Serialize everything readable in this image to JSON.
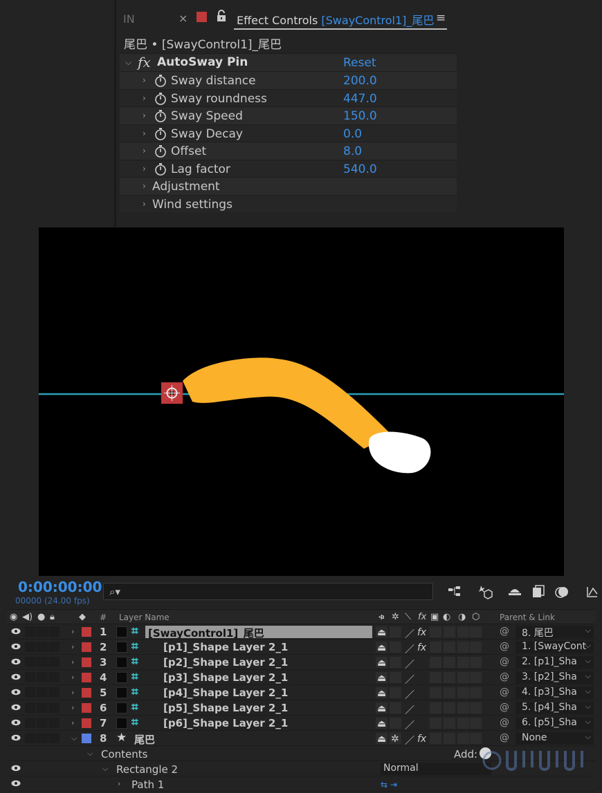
{
  "effect_controls": {
    "tab_in": "IN",
    "tab_close": "×",
    "tab_title": "Effect Controls",
    "tab_layer": "[SwayControl1]_尾巴",
    "menu_glyph": "≡",
    "breadcrumb": "尾巴 • [SwayControl1]_尾巴",
    "effect": {
      "name": "AutoSway Pin",
      "reset_label": "Reset",
      "fx_glyph": "fx"
    },
    "properties": [
      {
        "label": "Sway distance",
        "value": "200.0"
      },
      {
        "label": "Sway roundness",
        "value": "447.0"
      },
      {
        "label": "Sway Speed",
        "value": "150.0"
      },
      {
        "label": "Sway Decay",
        "value": "0.0"
      },
      {
        "label": "Offset",
        "value": "8.0"
      },
      {
        "label": "Lag factor",
        "value": "540.0"
      }
    ],
    "groups": [
      "Adjustment",
      "Wind settings"
    ]
  },
  "viewer": {
    "background": "#000000",
    "guide_color": "#2aa0b8",
    "tail_color": "#fbb12a",
    "tip_color": "#ffffff",
    "pin_color": "#c0393b"
  },
  "timeline": {
    "timecode": "0:00:00:00",
    "frames_fps": "00000 (24.00 fps)",
    "search_glyph": "⌕▾",
    "header": {
      "number": "#",
      "layer_name": "Layer Name",
      "parent_link": "Parent & Link"
    },
    "layers": [
      {
        "num": "1",
        "name": "[SwayControl1]_尾巴",
        "color": "#c0393b",
        "parent": "8. 尾巴",
        "fx": true,
        "selected": true
      },
      {
        "num": "2",
        "name": "[p1]_Shape Layer 2_1",
        "color": "#c0393b",
        "parent": "1. [SwayCont",
        "fx": true,
        "selected": false
      },
      {
        "num": "3",
        "name": "[p2]_Shape Layer 2_1",
        "color": "#c0393b",
        "parent": "2.  [p1]_Sha",
        "fx": false,
        "selected": false
      },
      {
        "num": "4",
        "name": "[p3]_Shape Layer 2_1",
        "color": "#c0393b",
        "parent": "3.  [p2]_Sha",
        "fx": false,
        "selected": false
      },
      {
        "num": "5",
        "name": "[p4]_Shape Layer 2_1",
        "color": "#c0393b",
        "parent": "4.  [p3]_Sha",
        "fx": false,
        "selected": false
      },
      {
        "num": "6",
        "name": "[p5]_Shape Layer 2_1",
        "color": "#c0393b",
        "parent": "5.  [p4]_Sha",
        "fx": false,
        "selected": false
      },
      {
        "num": "7",
        "name": "[p6]_Shape Layer 2_1",
        "color": "#c0393b",
        "parent": "6.  [p5]_Sha",
        "fx": false,
        "selected": false
      }
    ],
    "shape_layer": {
      "num": "8",
      "name": "尾巴",
      "color": "#5b7fe0",
      "parent": "None"
    },
    "contents_label": "Contents",
    "add_label": "Add:",
    "rectangle_label": "Rectangle 2",
    "blend_mode": "Normal",
    "path_label": "Path 1"
  }
}
